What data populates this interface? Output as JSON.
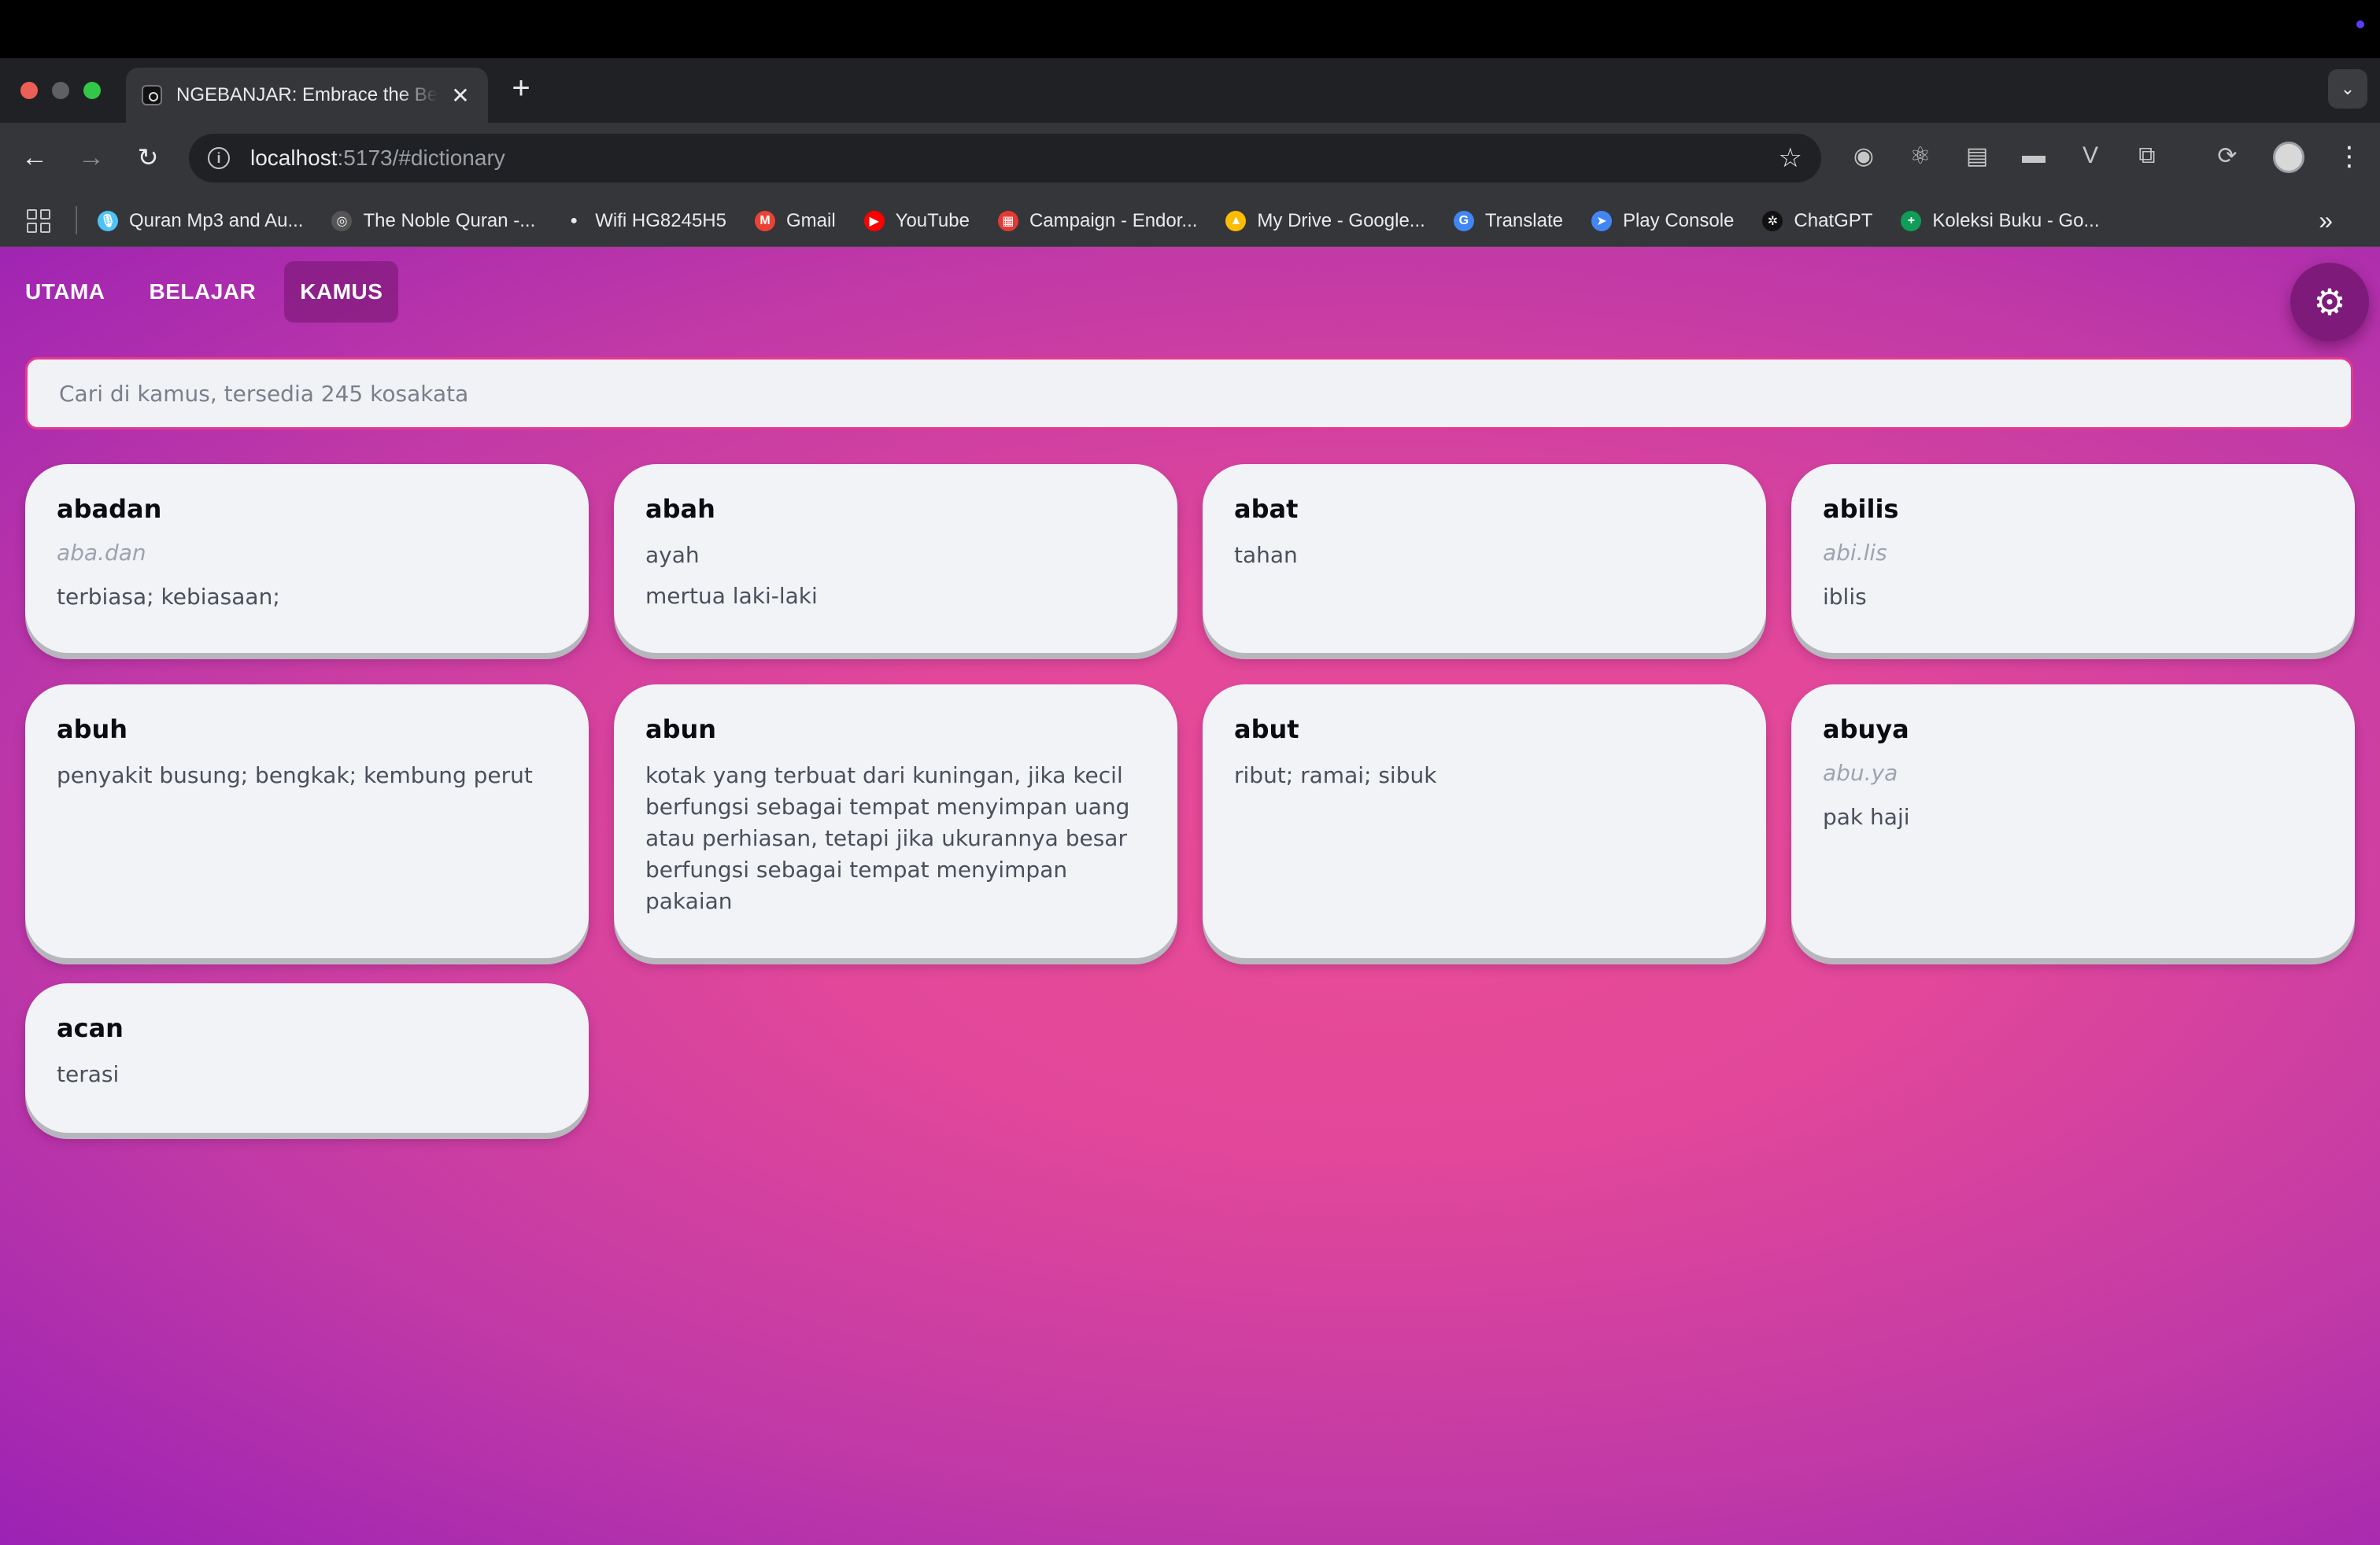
{
  "browser": {
    "tab_title": "NGEBANJAR: Embrace the Be",
    "url_host": "localhost",
    "url_rest": ":5173/#dictionary",
    "bookmarks": [
      {
        "label": "Quran Mp3 and Au...",
        "icon": "microphone-icon",
        "color": "#4fc3f7"
      },
      {
        "label": "The Noble Quran -...",
        "icon": "quran-icon",
        "color": "#555555"
      },
      {
        "label": "Wifi HG8245H5",
        "icon": "globe-icon",
        "color": "#e8eaed"
      },
      {
        "label": "Gmail",
        "icon": "gmail-icon",
        "color": "#ea4335"
      },
      {
        "label": "YouTube",
        "icon": "youtube-icon",
        "color": "#ff0000"
      },
      {
        "label": "Campaign - Endor...",
        "icon": "campaign-icon",
        "color": "#e53935"
      },
      {
        "label": "My Drive - Google...",
        "icon": "drive-icon",
        "color": "#fbbc04"
      },
      {
        "label": "Translate",
        "icon": "translate-icon",
        "color": "#4285f4"
      },
      {
        "label": "Play Console",
        "icon": "play-console-icon",
        "color": "#4285f4"
      },
      {
        "label": "ChatGPT",
        "icon": "chatgpt-icon",
        "color": "#111111"
      },
      {
        "label": "Koleksi Buku - Go...",
        "icon": "sheets-icon",
        "color": "#0f9d58"
      }
    ]
  },
  "app": {
    "nav": {
      "home": "UTAMA",
      "learn": "BELAJAR",
      "dictionary": "KAMUS"
    },
    "search_placeholder": "Cari di kamus, tersedia 245 kosakata",
    "accent_color": "#e8398e",
    "entries": [
      {
        "word": "abadan",
        "syllables": "aba.dan",
        "meanings": [
          "terbiasa; kebiasaan;"
        ]
      },
      {
        "word": "abah",
        "syllables": "",
        "meanings": [
          "ayah",
          "mertua laki-laki"
        ]
      },
      {
        "word": "abat",
        "syllables": "",
        "meanings": [
          "tahan"
        ]
      },
      {
        "word": "abilis",
        "syllables": "abi.lis",
        "meanings": [
          "iblis"
        ]
      },
      {
        "word": "abuh",
        "syllables": "",
        "meanings": [
          "penyakit busung; bengkak; kembung perut"
        ]
      },
      {
        "word": "abun",
        "syllables": "",
        "meanings": [
          "kotak yang terbuat dari kuningan, jika kecil berfungsi sebagai tempat menyimpan uang atau perhiasan, tetapi jika ukurannya besar berfungsi sebagai tempat menyimpan pakaian"
        ]
      },
      {
        "word": "abut",
        "syllables": "",
        "meanings": [
          "ribut; ramai; sibuk"
        ]
      },
      {
        "word": "abuya",
        "syllables": "abu.ya",
        "meanings": [
          "pak haji"
        ]
      },
      {
        "word": "acan",
        "syllables": "",
        "meanings": [
          "terasi"
        ]
      }
    ]
  }
}
